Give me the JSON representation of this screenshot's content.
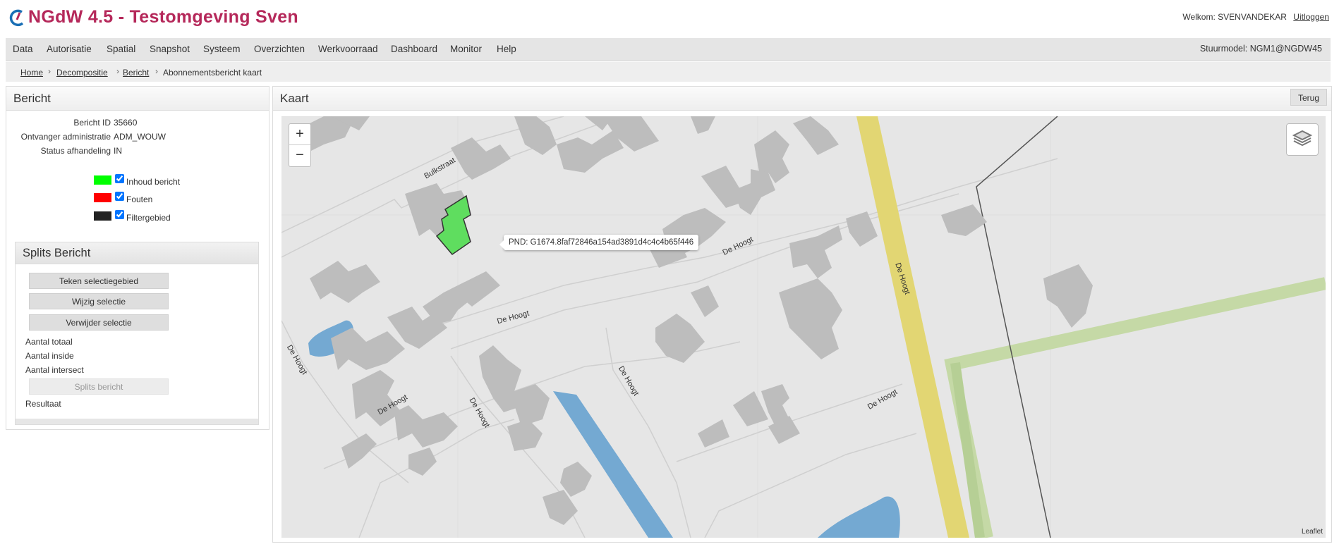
{
  "header": {
    "title": "NGdW 4.5 - Testomgeving Sven",
    "welcome_text": "Welkom: SVENVANDEKAR",
    "logout_label": "Uitloggen"
  },
  "menu": {
    "items": [
      "Data",
      "Autorisatie",
      "Spatial",
      "Snapshot",
      "Systeem",
      "Overzichten",
      "Werkvoorraad",
      "Dashboard",
      "Monitor",
      "Help"
    ],
    "stuurmodel": "Stuurmodel: NGM1@NGDW45"
  },
  "breadcrumb": {
    "items": [
      "Home",
      "Decompositie",
      "Bericht",
      "Abonnementsbericht kaart"
    ],
    "separator": "›"
  },
  "bericht": {
    "title": "Bericht",
    "fields": [
      {
        "label": "Bericht ID",
        "value": "35660"
      },
      {
        "label": "Ontvanger administratie",
        "value": "ADM_WOUW"
      },
      {
        "label": "Status afhandeling",
        "value": "IN"
      }
    ],
    "legend": [
      {
        "label": "Inhoud bericht",
        "color": "#00ff00",
        "checked": true
      },
      {
        "label": "Fouten",
        "color": "#ff0000",
        "checked": true
      },
      {
        "label": "Filtergebied",
        "color": "#222222",
        "checked": true
      }
    ]
  },
  "splits": {
    "title": "Splits Bericht",
    "buttons": [
      "Teken selectiegebied",
      "Wijzig selectie",
      "Verwijder selectie"
    ],
    "labels": [
      "Aantal totaal",
      "Aantal inside",
      "Aantal intersect"
    ],
    "split_button": "Splits bericht",
    "result_label": "Resultaat"
  },
  "kaart": {
    "title": "Kaart",
    "back_label": "Terug",
    "zoom_in": "+",
    "zoom_out": "−",
    "attribution": "Leaflet",
    "tooltip": "PND: G1674.8faf72846a154ad3891d4c4c4b65f446",
    "street_labels": [
      "Bulkstraat",
      "De Hoogt",
      "De Hoogt",
      "De Hoogt",
      "De Hoogt",
      "De Hoogt",
      "De Hoogt",
      "De Hoogt",
      "De Hoogt"
    ],
    "colors": {
      "background": "#e6e6e6",
      "building": "#bdbdbd",
      "selected_building": "#5fdd5f",
      "main_road": "#e2d673",
      "water": "#74a9d2",
      "path": "#c5d9a6"
    }
  },
  "icons": {
    "logo": "ngdw-logo-icon",
    "layers": "layers-icon"
  }
}
